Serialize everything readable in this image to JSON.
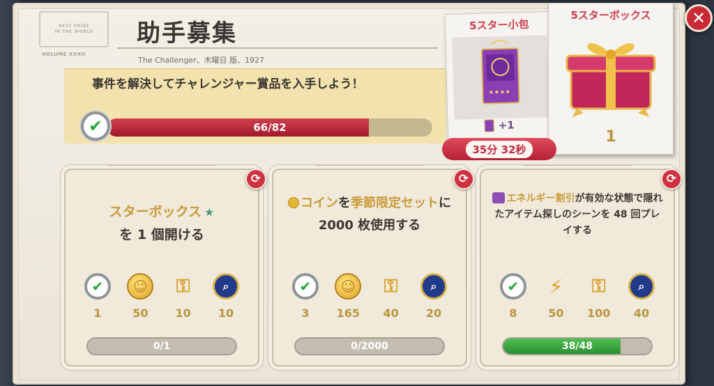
{
  "header": {
    "stamp_lines": [
      "BEST PRIZE",
      "IN THE WORLD"
    ],
    "volume_label": "VOLUME XXXII",
    "title": "助手募集",
    "subtitle": "The Challenger、木曜日 版、1927"
  },
  "main_quest": {
    "text": "事件を解決してチャレンジャー賞品を入手しよう！",
    "progress_current": 66,
    "progress_total": 82,
    "progress_label": "66/82",
    "progress_fraction": 0.805
  },
  "rewards_panel": {
    "small_card": {
      "title": "5スター小包",
      "plus_label": "+1",
      "icon": "purple-bag-icon"
    },
    "big_card": {
      "title": "5スターボックス",
      "count": "1",
      "icon": "pink-gift-box-icon"
    },
    "timer": "35分 32秒"
  },
  "close_button": {
    "icon": "close-icon",
    "glyph": "✕"
  },
  "tasks": [
    {
      "parts": {
        "a": "スターボックス",
        "b": "を 1 個開ける"
      },
      "rewards": [
        {
          "icon": "check-badge-icon",
          "value": "1"
        },
        {
          "icon": "coin-icon",
          "value": "50"
        },
        {
          "icon": "key-icon",
          "value": "10"
        },
        {
          "icon": "magnifier-badge-icon",
          "value": "10"
        }
      ],
      "progress_label": "0/1",
      "progress_fraction": 0
    },
    {
      "parts": {
        "a": "コイン",
        "b": "を",
        "c": "季節限定セット",
        "d": "に 2000 枚使用する"
      },
      "rewards": [
        {
          "icon": "check-badge-icon",
          "value": "3"
        },
        {
          "icon": "coin-icon",
          "value": "165"
        },
        {
          "icon": "key-icon",
          "value": "40"
        },
        {
          "icon": "magnifier-badge-icon",
          "value": "20"
        }
      ],
      "progress_label": "0/2000",
      "progress_fraction": 0
    },
    {
      "parts": {
        "a": "エネルギー割引",
        "b": "が有効な状態で隠れたアイテム探しのシーンを 48 回プレイする"
      },
      "rewards": [
        {
          "icon": "check-badge-icon",
          "value": "8"
        },
        {
          "icon": "lightning-icon",
          "value": "50"
        },
        {
          "icon": "key-icon",
          "value": "100"
        },
        {
          "icon": "magnifier-badge-icon",
          "value": "40"
        }
      ],
      "progress_label": "38/48",
      "progress_fraction": 0.792
    }
  ],
  "colors": {
    "accent_red": "#c92a37",
    "gold_text": "#b89540",
    "highlight": "#c99a3a",
    "progress_green": "#2c8f33",
    "progress_red": "#a1192a"
  }
}
